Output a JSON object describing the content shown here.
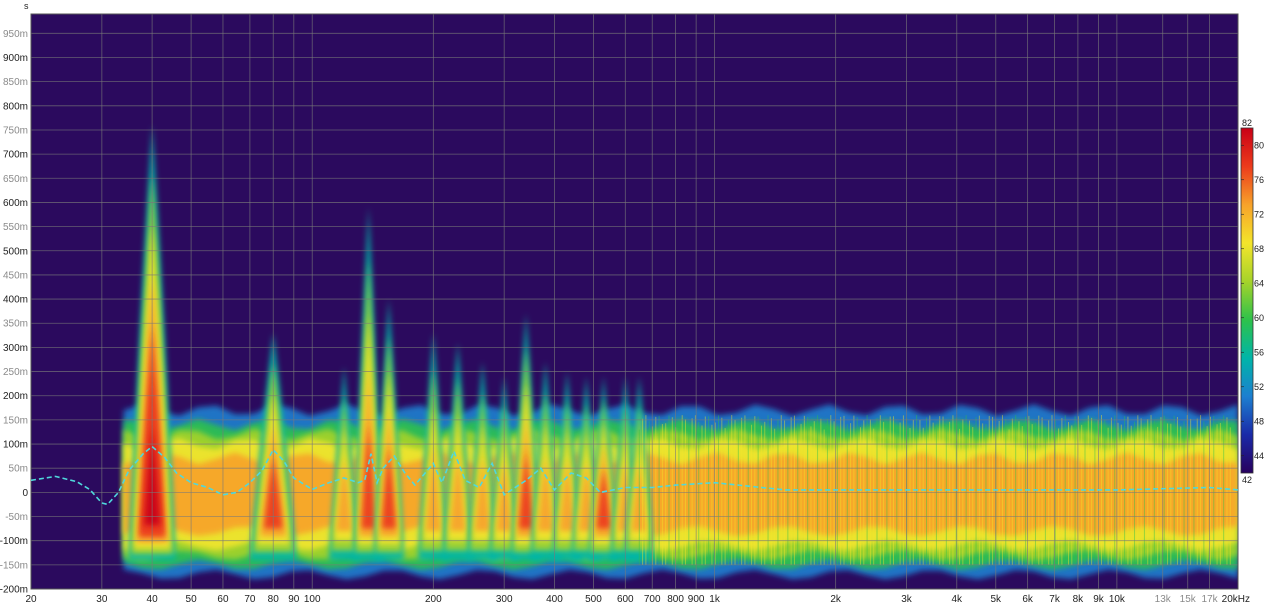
{
  "chart_data": {
    "type": "heatmap",
    "description_kind": "spectrogram",
    "y_unit": "s",
    "x_unit": "kHz",
    "x_scale": "log",
    "xlim": [
      20,
      20000
    ],
    "ylim": [
      -0.2,
      0.99
    ],
    "x_ticks": [
      {
        "value": 20,
        "label": "20"
      },
      {
        "value": 30,
        "label": "30"
      },
      {
        "value": 40,
        "label": "40"
      },
      {
        "value": 50,
        "label": "50"
      },
      {
        "value": 60,
        "label": "60"
      },
      {
        "value": 70,
        "label": "70"
      },
      {
        "value": 80,
        "label": "80"
      },
      {
        "value": 90,
        "label": "90"
      },
      {
        "value": 100,
        "label": "100"
      },
      {
        "value": 200,
        "label": "200"
      },
      {
        "value": 300,
        "label": "300"
      },
      {
        "value": 400,
        "label": "400"
      },
      {
        "value": 500,
        "label": "500"
      },
      {
        "value": 600,
        "label": "600"
      },
      {
        "value": 700,
        "label": "700"
      },
      {
        "value": 800,
        "label": "800"
      },
      {
        "value": 900,
        "label": "900"
      },
      {
        "value": 1000,
        "label": "1k"
      },
      {
        "value": 2000,
        "label": "2k"
      },
      {
        "value": 3000,
        "label": "3k"
      },
      {
        "value": 4000,
        "label": "4k"
      },
      {
        "value": 5000,
        "label": "5k"
      },
      {
        "value": 6000,
        "label": "6k"
      },
      {
        "value": 7000,
        "label": "7k"
      },
      {
        "value": 8000,
        "label": "8k"
      },
      {
        "value": 9000,
        "label": "9k"
      },
      {
        "value": 10000,
        "label": "10k"
      },
      {
        "value": 13000,
        "label": "13k",
        "faint": true
      },
      {
        "value": 15000,
        "label": "15k",
        "faint": true
      },
      {
        "value": 17000,
        "label": "17k",
        "faint": true
      },
      {
        "value": 20000,
        "label": "20kHz"
      }
    ],
    "y_ticks": [
      {
        "value": 0.95,
        "label": "950m",
        "faint": true
      },
      {
        "value": 0.9,
        "label": "900m"
      },
      {
        "value": 0.85,
        "label": "850m",
        "faint": true
      },
      {
        "value": 0.8,
        "label": "800m"
      },
      {
        "value": 0.75,
        "label": "750m",
        "faint": true
      },
      {
        "value": 0.7,
        "label": "700m"
      },
      {
        "value": 0.65,
        "label": "650m",
        "faint": true
      },
      {
        "value": 0.6,
        "label": "600m"
      },
      {
        "value": 0.55,
        "label": "550m",
        "faint": true
      },
      {
        "value": 0.5,
        "label": "500m"
      },
      {
        "value": 0.45,
        "label": "450m",
        "faint": true
      },
      {
        "value": 0.4,
        "label": "400m"
      },
      {
        "value": 0.35,
        "label": "350m",
        "faint": true
      },
      {
        "value": 0.3,
        "label": "300m"
      },
      {
        "value": 0.25,
        "label": "250m",
        "faint": true
      },
      {
        "value": 0.2,
        "label": "200m"
      },
      {
        "value": 0.15,
        "label": "150m",
        "faint": true
      },
      {
        "value": 0.1,
        "label": "100m"
      },
      {
        "value": 0.05,
        "label": "50m",
        "faint": true
      },
      {
        "value": 0.0,
        "label": "0"
      },
      {
        "value": -0.05,
        "label": "-50m",
        "faint": true
      },
      {
        "value": -0.1,
        "label": "-100m"
      },
      {
        "value": -0.15,
        "label": "-150m",
        "faint": true
      },
      {
        "value": -0.2,
        "label": "-200m"
      }
    ],
    "colorbar": {
      "range": [
        42,
        82
      ],
      "ticks": [
        "82",
        "80",
        "76",
        "72",
        "68",
        "64",
        "60",
        "56",
        "52",
        "48",
        "44",
        "42"
      ],
      "tick_values": [
        82,
        80,
        76,
        72,
        68,
        64,
        60,
        56,
        52,
        48,
        44,
        42
      ],
      "stops": [
        "#27005e",
        "#1a2aa8",
        "#1c7fd0",
        "#00b5a8",
        "#2ec24a",
        "#a6d32a",
        "#f4e52b",
        "#f7a22a",
        "#ec3b1c",
        "#c90016"
      ]
    },
    "background_color": "#2b0a5e",
    "grid": true,
    "grid_color": "#7a7a7a",
    "ridges": [
      {
        "freq": 40,
        "top": 0.76,
        "peak_db": 81
      },
      {
        "freq": 80,
        "top": 0.33,
        "peak_db": 77
      },
      {
        "freq": 120,
        "top": 0.26,
        "peak_db": 75
      },
      {
        "freq": 138,
        "top": 0.59,
        "peak_db": 76
      },
      {
        "freq": 155,
        "top": 0.4,
        "peak_db": 77
      },
      {
        "freq": 200,
        "top": 0.33,
        "peak_db": 74
      },
      {
        "freq": 230,
        "top": 0.31,
        "peak_db": 73
      },
      {
        "freq": 265,
        "top": 0.27,
        "peak_db": 73
      },
      {
        "freq": 300,
        "top": 0.24,
        "peak_db": 72
      },
      {
        "freq": 340,
        "top": 0.37,
        "peak_db": 78
      },
      {
        "freq": 380,
        "top": 0.27,
        "peak_db": 73
      },
      {
        "freq": 430,
        "top": 0.25,
        "peak_db": 75
      },
      {
        "freq": 480,
        "top": 0.24,
        "peak_db": 74
      },
      {
        "freq": 530,
        "top": 0.24,
        "peak_db": 76
      },
      {
        "freq": 600,
        "top": 0.24,
        "peak_db": 74
      },
      {
        "freq": 650,
        "top": 0.24,
        "peak_db": 74
      }
    ],
    "cutoff_line": {
      "color": "#4fd8dc",
      "style": "dashed",
      "points": [
        [
          20,
          0.025
        ],
        [
          23,
          0.033
        ],
        [
          26,
          0.022
        ],
        [
          28,
          0.006
        ],
        [
          30,
          -0.022
        ],
        [
          31,
          -0.025
        ],
        [
          33,
          0.0
        ],
        [
          35,
          0.045
        ],
        [
          38,
          0.08
        ],
        [
          40,
          0.095
        ],
        [
          43,
          0.072
        ],
        [
          46,
          0.04
        ],
        [
          50,
          0.02
        ],
        [
          55,
          0.01
        ],
        [
          60,
          -0.005
        ],
        [
          65,
          0.0
        ],
        [
          70,
          0.02
        ],
        [
          75,
          0.045
        ],
        [
          80,
          0.088
        ],
        [
          85,
          0.065
        ],
        [
          90,
          0.03
        ],
        [
          100,
          0.006
        ],
        [
          110,
          0.02
        ],
        [
          120,
          0.03
        ],
        [
          130,
          0.02
        ],
        [
          135,
          0.025
        ],
        [
          140,
          0.08
        ],
        [
          145,
          0.02
        ],
        [
          150,
          0.05
        ],
        [
          160,
          0.075
        ],
        [
          170,
          0.04
        ],
        [
          180,
          0.015
        ],
        [
          200,
          0.06
        ],
        [
          210,
          0.02
        ],
        [
          225,
          0.085
        ],
        [
          240,
          0.025
        ],
        [
          260,
          0.01
        ],
        [
          280,
          0.06
        ],
        [
          300,
          -0.005
        ],
        [
          340,
          0.025
        ],
        [
          370,
          0.05
        ],
        [
          400,
          0.005
        ],
        [
          440,
          0.04
        ],
        [
          480,
          0.03
        ],
        [
          520,
          0.0
        ],
        [
          600,
          0.01
        ],
        [
          700,
          0.01
        ],
        [
          800,
          0.015
        ],
        [
          1000,
          0.02
        ],
        [
          1500,
          0.005
        ],
        [
          3000,
          0.005
        ],
        [
          10000,
          0.005
        ],
        [
          17000,
          0.01
        ],
        [
          20000,
          0.005
        ]
      ]
    }
  }
}
